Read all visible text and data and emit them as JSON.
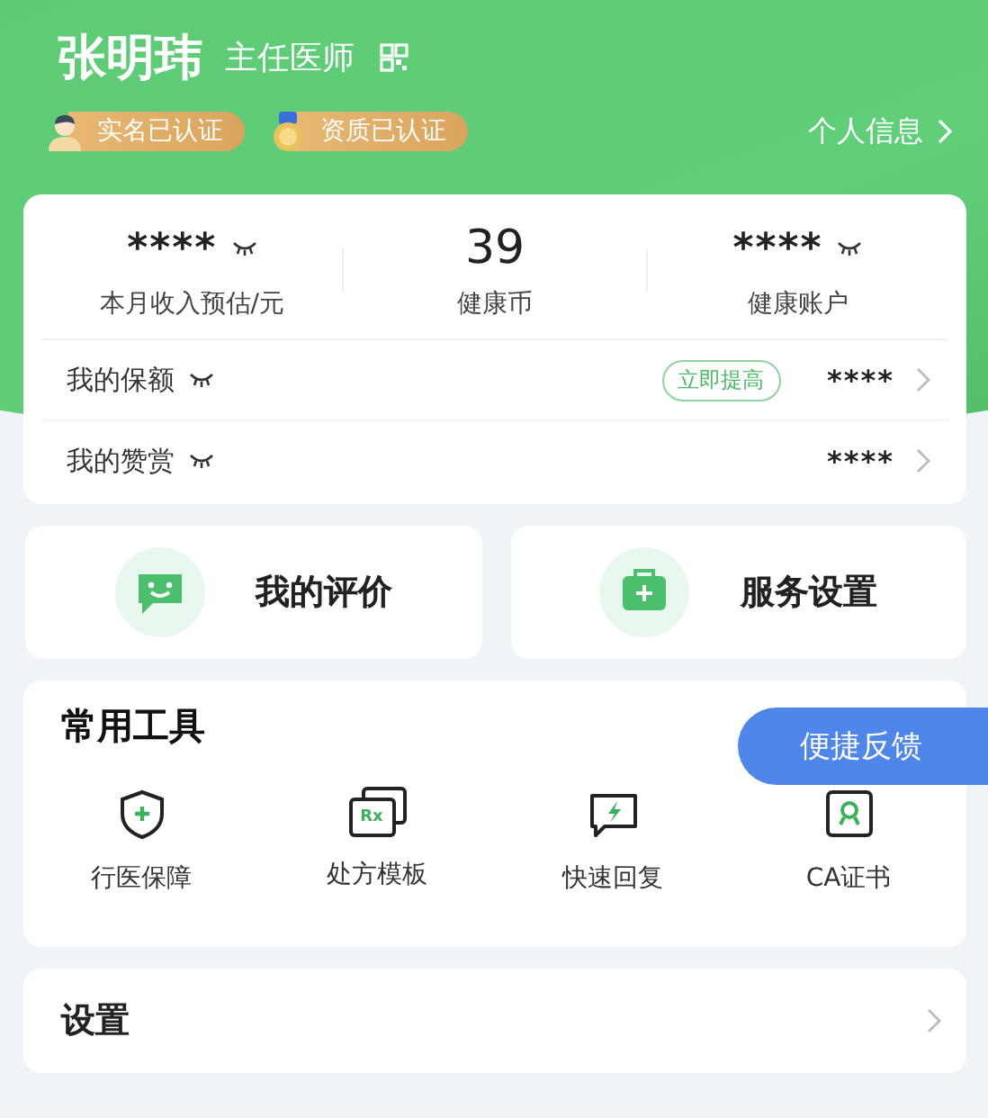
{
  "profile": {
    "name": "张明玮",
    "title": "主任医师",
    "badges": [
      {
        "kind": "person",
        "label": "实名已认证"
      },
      {
        "kind": "medal",
        "label": "资质已认证"
      }
    ],
    "info_link": "个人信息"
  },
  "stats": [
    {
      "value": "****",
      "label": "本月收入预估/元",
      "hidden": true
    },
    {
      "value": "39",
      "label": "健康币",
      "hidden": false
    },
    {
      "value": "****",
      "label": "健康账户",
      "hidden": true
    }
  ],
  "rows": [
    {
      "label": "我的保额",
      "action": "立即提高",
      "value": "****"
    },
    {
      "label": "我的赞赏",
      "value": "****"
    }
  ],
  "shortcuts": [
    {
      "kind": "review",
      "label": "我的评价"
    },
    {
      "kind": "service",
      "label": "服务设置"
    }
  ],
  "tools": {
    "title": "常用工具",
    "items": [
      {
        "kind": "shield",
        "label": "行医保障"
      },
      {
        "kind": "rx",
        "label": "处方模板",
        "icon_text": "Rx"
      },
      {
        "kind": "reply",
        "label": "快速回复"
      },
      {
        "kind": "cert",
        "label": "CA证书"
      }
    ]
  },
  "feedback_button": "便捷反馈",
  "settings": "设置"
}
